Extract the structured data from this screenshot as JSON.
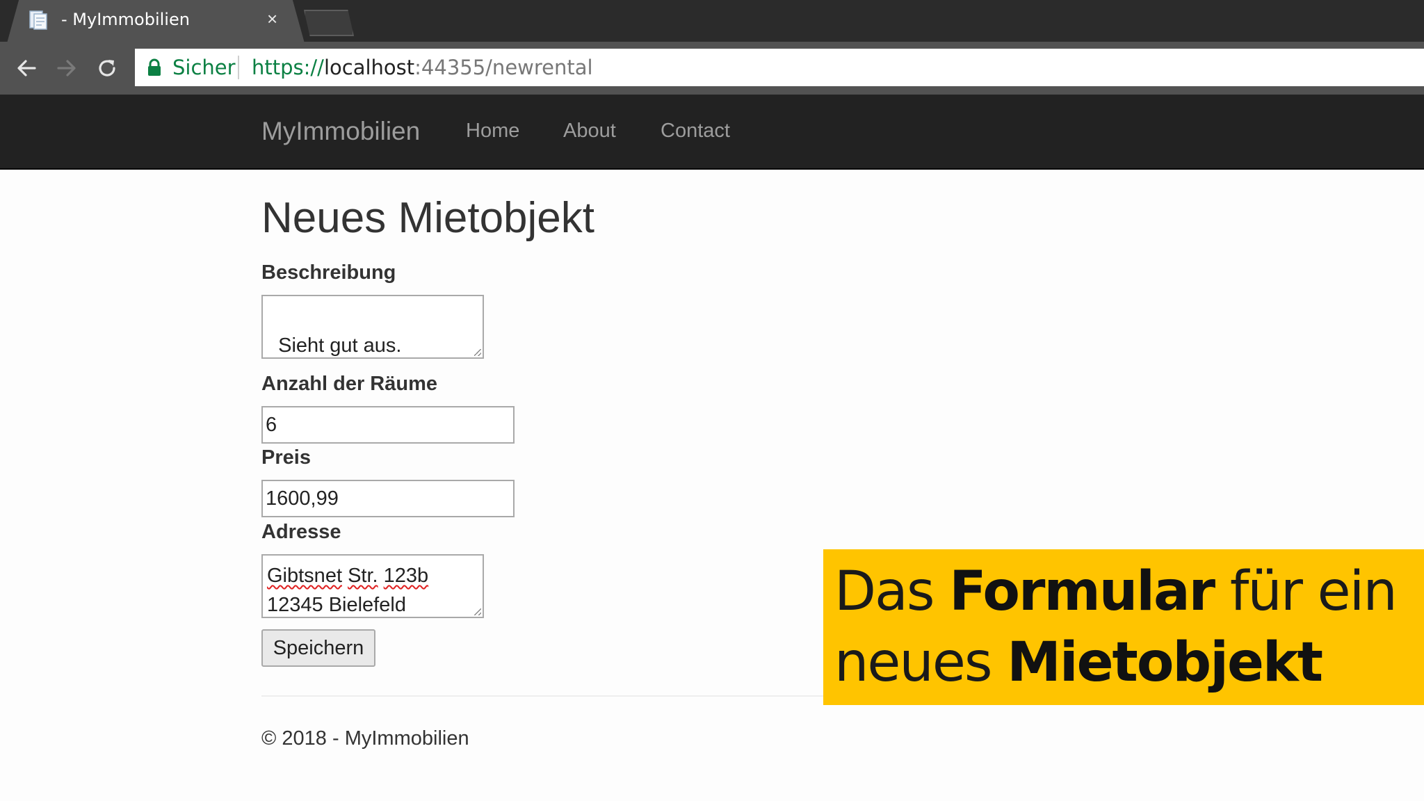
{
  "browser": {
    "tab_title": "- MyImmobilien",
    "tab_close": "×",
    "secure_label": "Sicher",
    "url_scheme": "https://",
    "url_host": "localhost",
    "url_rest": ":44355/newrental",
    "secure_color": "#0b8043"
  },
  "navbar": {
    "brand": "MyImmobilien",
    "links": [
      "Home",
      "About",
      "Contact"
    ]
  },
  "page": {
    "title": "Neues Mietobjekt"
  },
  "form": {
    "description_label": "Beschreibung",
    "description_value": "Sieht gut aus.",
    "rooms_label": "Anzahl der Räume",
    "rooms_value": "6",
    "price_label": "Preis",
    "price_value": "1600,99",
    "address_label": "Adresse",
    "address_line1_word1": "Gibtsnet",
    "address_line1_word2": "Str.",
    "address_line1_word3": "123b",
    "address_line2": "12345 Bielefeld",
    "save_label": "Speichern"
  },
  "footer": {
    "text": "© 2018 - MyImmobilien"
  },
  "overlay": {
    "line1_part1": "Das ",
    "line1_part2": "Formular",
    "line1_part3": " für ein",
    "line2_part1": "neues ",
    "line2_part2": "Mietobjekt",
    "background_color": "#ffc400"
  }
}
